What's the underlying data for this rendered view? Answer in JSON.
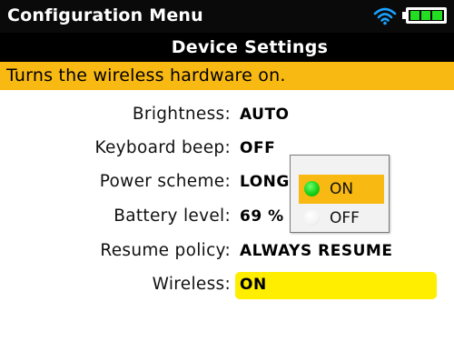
{
  "titlebar": {
    "title": "Configuration Menu",
    "wifi_icon": "wifi-icon",
    "battery_icon": "battery-icon"
  },
  "section": {
    "title": "Device Settings"
  },
  "help": {
    "text": "Turns the wireless hardware on."
  },
  "settings": [
    {
      "label": "Brightness:",
      "value": "AUTO"
    },
    {
      "label": "Keyboard beep:",
      "value": "OFF"
    },
    {
      "label": "Power scheme:",
      "value": "LONG"
    },
    {
      "label": "Battery level:",
      "value": "69 %"
    },
    {
      "label": "Resume policy:",
      "value": "ALWAYS RESUME"
    },
    {
      "label": "Wireless:",
      "value": "ON"
    }
  ],
  "popup": {
    "options": [
      {
        "label": "ON",
        "selected": true
      },
      {
        "label": "OFF",
        "selected": false
      }
    ]
  },
  "colors": {
    "title_bg": "#0a0a0a",
    "help_bg": "#f9b913",
    "selected_value_bg": "#ffee00",
    "popup_highlight": "#f9b913",
    "radio_on": "#17d017",
    "wifi": "#1aa3ff",
    "battery_fill": "#22dd22"
  }
}
